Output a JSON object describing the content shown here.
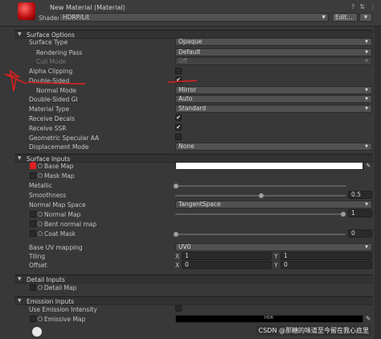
{
  "header": {
    "title": "New Material (Material)",
    "shader_label": "Shader",
    "shader_value": "HDRP/Lit",
    "edit_label": "Edit...",
    "icons": [
      "help-icon",
      "preset-icon",
      "more-icon"
    ]
  },
  "surface_options": {
    "title": "Surface Options",
    "rows": [
      {
        "label": "Surface Type",
        "value": "Opaque"
      },
      {
        "label": "Rendering Pass",
        "value": "Default"
      },
      {
        "label": "Cull Mode",
        "value": "Off"
      },
      {
        "label": "Alpha Clipping",
        "checked": false
      },
      {
        "label": "Double-Sided",
        "checked": true
      },
      {
        "label": "Normal Mode",
        "value": "Mirror"
      },
      {
        "label": "Double-Sided GI",
        "value": "Auto"
      },
      {
        "label": "Material Type",
        "value": "Standard"
      },
      {
        "label": "Receive Decals",
        "checked": true
      },
      {
        "label": "Receive SSR",
        "checked": true
      },
      {
        "label": "Geometric Specular AA",
        "checked": false
      },
      {
        "label": "Displacement Mode",
        "value": "None"
      }
    ]
  },
  "surface_inputs": {
    "title": "Surface Inputs",
    "base_map": "Base Map",
    "mask_map": "Mask Map",
    "metallic": {
      "label": "Metallic",
      "value": 0
    },
    "smoothness": {
      "label": "Smoothness",
      "value": "0.5"
    },
    "normal_map_space": {
      "label": "Normal Map Space",
      "value": "TangentSpace"
    },
    "normal_map": {
      "label": "Normal Map",
      "value": "1"
    },
    "bent_normal_map": "Bent normal map",
    "coat_mask": {
      "label": "Coat Mask",
      "value": "0"
    },
    "base_uv_mapping": {
      "label": "Base UV mapping",
      "value": "UV0"
    },
    "tiling": {
      "label": "Tiling",
      "x_label": "X",
      "x": "1",
      "y_label": "Y",
      "y": "1"
    },
    "offset": {
      "label": "Offset",
      "x_label": "X",
      "x": "0",
      "y_label": "Y",
      "y": "0"
    }
  },
  "detail_inputs": {
    "title": "Detail Inputs",
    "detail_map": "Detail Map"
  },
  "emission_inputs": {
    "title": "Emission Inputs",
    "use_emission_intensity": "Use Emission Intensity",
    "emissive_map": "Emissive Map",
    "hdr_label": "HDR"
  },
  "watermark": "CSDN @那糖的味道至今留在我心底里",
  "colors": {
    "panel": "#383838",
    "annotation_red": "#e02020",
    "base_color": "#ffffff"
  }
}
